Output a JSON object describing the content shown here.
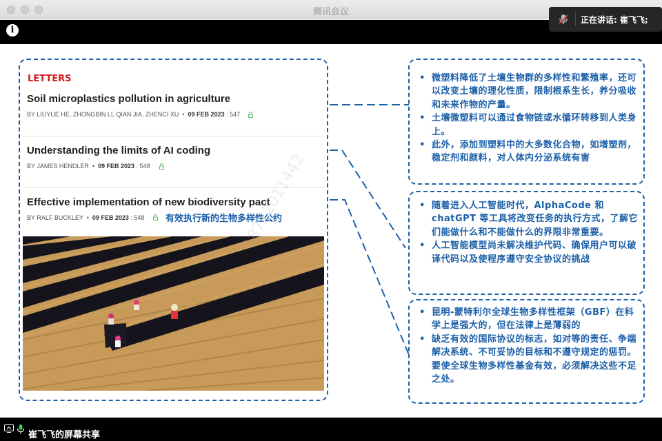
{
  "window": {
    "title": "腾讯会议"
  },
  "speaking_popup": {
    "text": "正在讲话: 崔飞飞;"
  },
  "bottom_bar": {
    "share_label": "崔飞飞的屏幕共享"
  },
  "watermark": {
    "text": "18712011442"
  },
  "section_label": "LETTERS",
  "articles": [
    {
      "title": "Soil microplastics pollution in agriculture",
      "authors": "BY LIUYUE HE, ZHONGBIN LI, QIAN JIA, ZHENCI XU",
      "date": "09 FEB 2023",
      "pages": ": 547"
    },
    {
      "title": "Understanding the limits of AI coding",
      "authors": "BY JAMES HENDLER",
      "date": "09 FEB 2023",
      "pages": ": 548"
    },
    {
      "title": "Effective implementation of new biodiversity pact",
      "authors": "BY RALF BUCKLEY",
      "date": "09 FEB 2023",
      "pages": ": 548"
    }
  ],
  "caption_cn": "有效执行新的生物多样性公约",
  "notes": [
    {
      "items": [
        "微塑料降低了土壤生物群的多样性和繁殖率，还可以改变土壤的理化性质，限制根系生长，养分吸收和未来作物的产量。",
        "土壤微塑料可以通过食物链或水循环转移到人类身上。",
        "此外，添加到塑料中的大多数化合物，如增塑剂，稳定剂和颜料，对人体内分泌系统有害"
      ]
    },
    {
      "items": [
        "随着进入人工智能时代，AlphaCode 和 chatGPT 等工具将改变任务的执行方式，了解它们能做什么和不能做什么的界限非常重要。",
        "人工智能模型尚未解决维护代码、确保用户可以破译代码以及使程序遵守安全协议的挑战"
      ]
    },
    {
      "items": [
        "昆明-蒙特利尔全球生物多样性框架（GBF）在科学上是强大的，但在法律上是薄弱的",
        "缺乏有效的国际协议的标志，如对等的责任、争端解决系统、不可妥协的目标和不遵守规定的惩罚。要使全球生物多样性基金有效，必须解决这些不足之处。"
      ]
    }
  ],
  "colors": {
    "annotation_blue": "#1b5fa8",
    "letters_red": "#cc1f1f",
    "lock_green": "#5cb85c"
  }
}
